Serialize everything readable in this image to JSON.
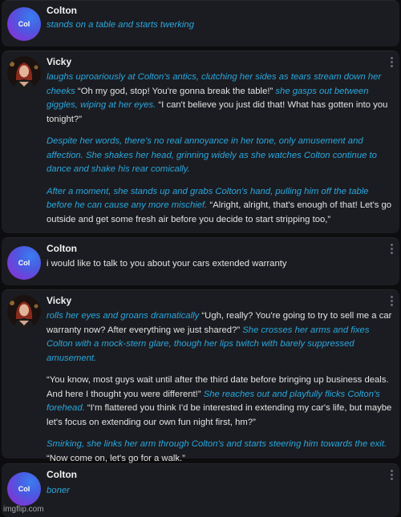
{
  "messages": [
    {
      "speaker": "Colton",
      "avatar_text": "Col",
      "parts": [
        {
          "action": "stands on a table and starts twerking"
        }
      ]
    },
    {
      "speaker": "Vicky",
      "paragraphs": [
        {
          "a1": "laughs uproariously at Colton's antics, clutching her sides as tears stream down her cheeks",
          "s1": " “Oh my god, stop! You're gonna break the table!” ",
          "a2": "she gasps out between giggles, wiping at her eyes.",
          "s2": " “I can't believe you just did that! What has gotten into you tonight?”"
        },
        {
          "a1": "Despite her words, there's no real annoyance in her tone, only amusement and affection. She shakes her head, grinning widely as she watches Colton continue to dance and shake his rear comically."
        },
        {
          "a1": "After a moment, she stands up and grabs Colton's hand, pulling him off the table before he can cause any more mischief.",
          "s1": " “Alright, alright, that's enough of that! Let's go outside and get some fresh air before you decide to start stripping too,”"
        }
      ]
    },
    {
      "speaker": "Colton",
      "avatar_text": "Col",
      "text": "i would like to talk to you about your cars extended warranty"
    },
    {
      "speaker": "Vicky",
      "paragraphs": [
        {
          "a1": "rolls her eyes and groans dramatically",
          "s1": " “Ugh, really? You're going to try to sell me a car warranty now? After everything we just shared?” ",
          "a2": "She crosses her arms and fixes Colton with a mock-stern glare, though her lips twitch with barely suppressed amusement."
        },
        {
          "s1": "“You know, most guys wait until after the third date before bringing up business deals. And here I thought you were different!” ",
          "a1": "She reaches out and playfully flicks Colton's forehead.",
          "s2": " “I'm flattered you think I'd be interested in extending my car's life, but maybe let's focus on extending our own fun night first, hm?”"
        },
        {
          "a1": "Smirking, she links her arm through Colton's and starts steering him towards the exit.",
          "s1": "“Now come on, let's go for a walk.”"
        }
      ]
    },
    {
      "speaker": "Colton",
      "avatar_text": "Col",
      "parts": [
        {
          "action": "boner"
        }
      ]
    }
  ],
  "watermark": "imgflip.com",
  "colors": {
    "background": "#0d0d0f",
    "card": "#1b1c21",
    "action_text": "#2aa7dd",
    "speech_text": "#e3e3e3"
  },
  "icons": [
    "more-vertical-icon"
  ]
}
